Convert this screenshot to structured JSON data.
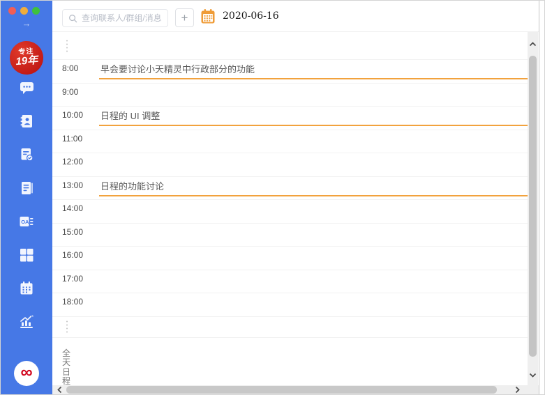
{
  "colors": {
    "sidebar_bg": "#4678e6",
    "accent_orange": "#f2a23d",
    "avatar_red": "#c41212",
    "logo_red": "#d0021b",
    "traffic_red": "#f25e56",
    "traffic_yellow": "#f0ad3c",
    "traffic_green": "#3fc13d"
  },
  "sidebar": {
    "collapse_arrow": "→",
    "avatar": {
      "line1": "专注",
      "line2": "19年"
    },
    "items": [
      {
        "id": "messages",
        "icon": "chat-icon"
      },
      {
        "id": "contacts",
        "icon": "contacts-icon"
      },
      {
        "id": "tasks",
        "icon": "task-icon"
      },
      {
        "id": "notes",
        "icon": "notebook-icon"
      },
      {
        "id": "oa",
        "icon": "oa-icon",
        "label": "OA"
      },
      {
        "id": "apps",
        "icon": "grid-icon"
      },
      {
        "id": "calendar",
        "icon": "calendar-icon"
      },
      {
        "id": "stats",
        "icon": "chart-icon"
      }
    ],
    "footer_logo": "∞"
  },
  "topbar": {
    "search_placeholder": "查询联系人/群组/消息",
    "search_value": "",
    "add_button": "+",
    "date": "2020-06-16"
  },
  "schedule": {
    "hours": [
      "8:00",
      "9:00",
      "10:00",
      "11:00",
      "12:00",
      "13:00",
      "14:00",
      "15:00",
      "16:00",
      "17:00",
      "18:00"
    ],
    "events": [
      {
        "time": "8:00",
        "title": "早会要讨论小天精灵中行政部分的功能"
      },
      {
        "time": "10:00",
        "title": "日程的 UI 调整"
      },
      {
        "time": "13:00",
        "title": "日程的功能讨论"
      }
    ],
    "all_day_label": "全天日程"
  }
}
